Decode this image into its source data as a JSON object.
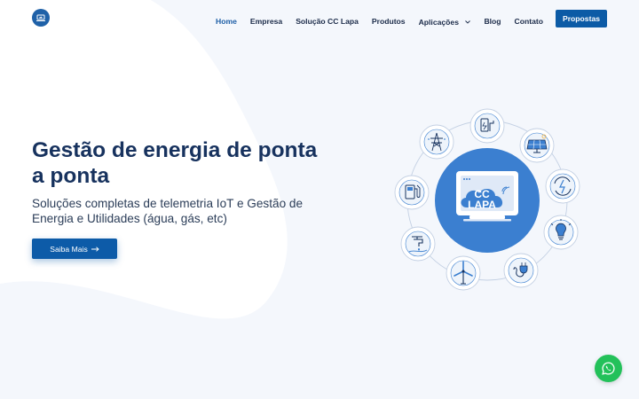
{
  "brand": {
    "logo_icon": "cloud-laptop-icon",
    "accent": "#0c5ba6"
  },
  "nav": {
    "items": [
      {
        "label": "Home",
        "active": true
      },
      {
        "label": "Empresa"
      },
      {
        "label": "Solução CC Lapa"
      },
      {
        "label": "Produtos"
      },
      {
        "label": "Aplicações",
        "dropdown": true
      },
      {
        "label": "Blog"
      },
      {
        "label": "Contato"
      }
    ],
    "cta_label": "Propostas"
  },
  "hero": {
    "title": "Gestão de energia de ponta a ponta",
    "subtitle": "Soluções completas de telemetria IoT e Gestão de Energia e Utilidades (água, gás, etc)",
    "button_label": "Saiba Mais",
    "button_icon": "arrow-right-icon"
  },
  "illustration": {
    "center_text_line1": "CC",
    "center_text_line2": "LAPA",
    "icons": [
      "phone-charger-icon",
      "solar-panel-icon",
      "energy-refresh-icon",
      "lightbulb-icon",
      "electric-plug-icon",
      "wind-turbine-icon",
      "faucet-icon",
      "fuel-pump-icon",
      "power-tower-icon"
    ]
  },
  "whatsapp": {
    "icon": "whatsapp-icon",
    "color": "#23c15a"
  }
}
